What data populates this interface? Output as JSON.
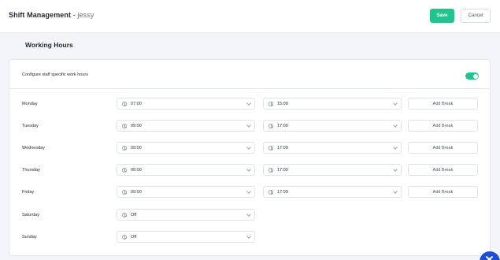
{
  "header": {
    "title": "Shift Management",
    "separator": " - ",
    "subtitle": "jessy",
    "save_label": "Save",
    "cancel_label": "Cancel"
  },
  "section_title": "Working Hours",
  "config": {
    "label": "Configure staff specific work hours",
    "enabled": true
  },
  "days": [
    {
      "name": "Monday",
      "start": "07:00",
      "end": "15:00",
      "break_label": "Add Break"
    },
    {
      "name": "Tuesday",
      "start": "09:00",
      "end": "17:00",
      "break_label": "Add Break"
    },
    {
      "name": "Wednesday",
      "start": "09:00",
      "end": "17:00",
      "break_label": "Add Break"
    },
    {
      "name": "Thursday",
      "start": "09:00",
      "end": "17:00",
      "break_label": "Add Break"
    },
    {
      "name": "Friday",
      "start": "09:00",
      "end": "17:00",
      "break_label": "Add Break"
    },
    {
      "name": "Saturday",
      "start": "Off"
    },
    {
      "name": "Sunday",
      "start": "Off"
    }
  ],
  "colors": {
    "accent": "#22c38e",
    "fab": "#1c4fd6"
  }
}
